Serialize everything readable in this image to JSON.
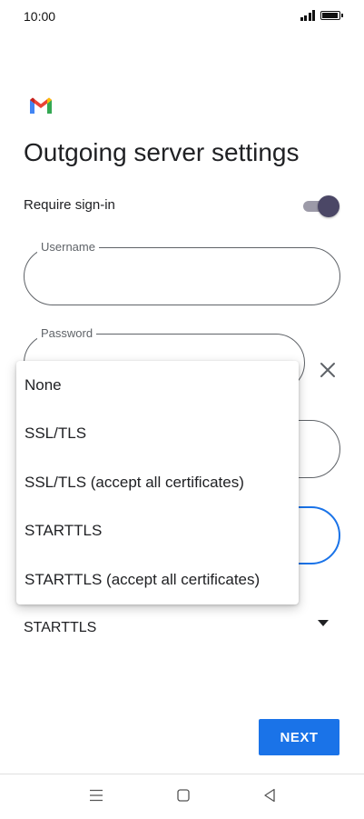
{
  "status_bar": {
    "time": "10:00"
  },
  "app": {
    "logo_icon": "gmail-logo-icon"
  },
  "page": {
    "title": "Outgoing server settings"
  },
  "require_signin": {
    "label": "Require sign-in",
    "enabled": true
  },
  "fields": {
    "username": {
      "label": "Username",
      "value": ""
    },
    "password": {
      "label": "Password",
      "value": ""
    }
  },
  "security": {
    "selected": "STARTTLS"
  },
  "menu": {
    "options": [
      "None",
      "SSL/TLS",
      "SSL/TLS (accept all certificates)",
      "STARTTLS",
      "STARTTLS (accept all certificates)"
    ]
  },
  "actions": {
    "next_label": "NEXT"
  },
  "colors": {
    "accent": "#1a73e8",
    "toggle_on": "#4b4766"
  }
}
